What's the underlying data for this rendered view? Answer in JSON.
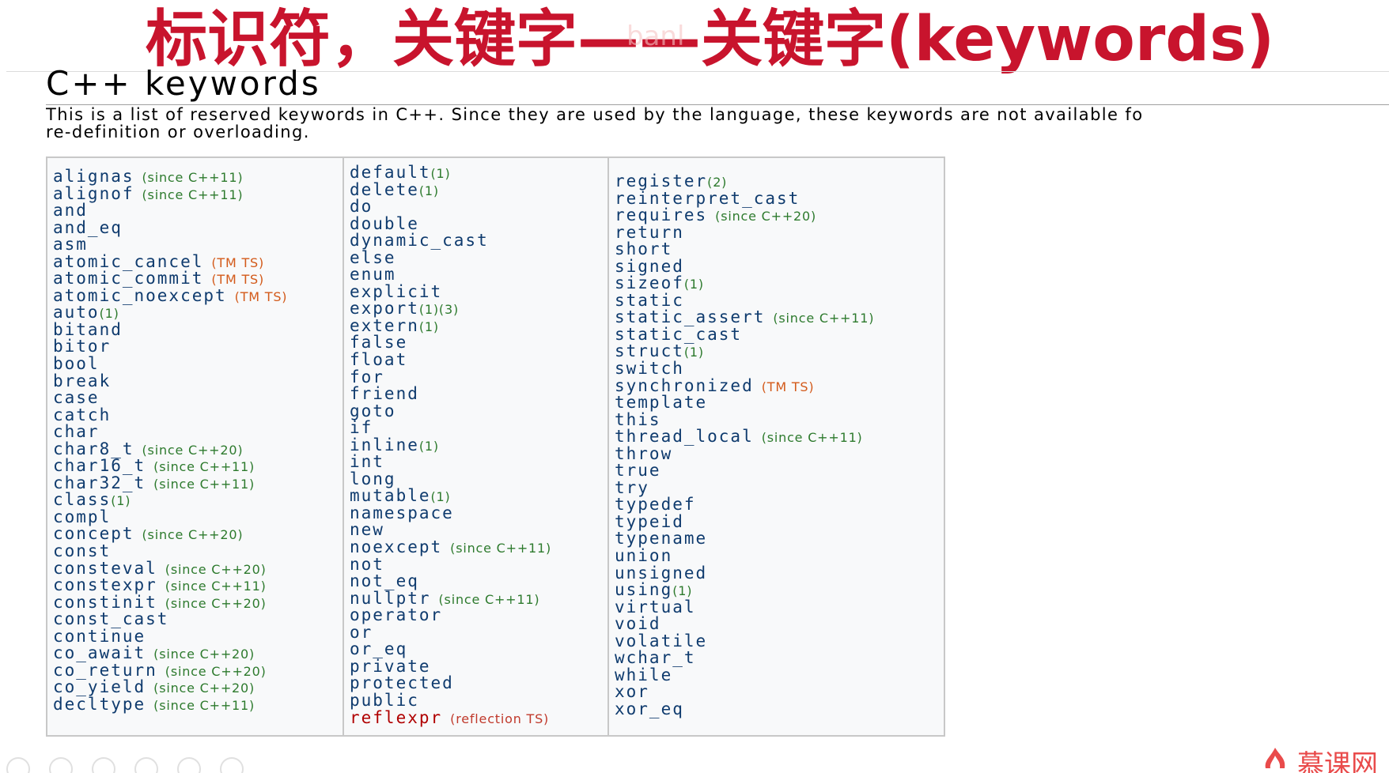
{
  "slide": {
    "title": "标识符，关键字——关键字(keywords)",
    "watermark": "banl",
    "brand": "慕课网",
    "title_color": "#c8142d"
  },
  "page": {
    "heading": "C++ keywords",
    "intro_line1": "This is a list of reserved keywords in C++. Since they are used by the language, these keywords are not available fo",
    "intro_line2": "re-definition or overloading."
  },
  "colors": {
    "keyword": "#0f3b6e",
    "note_green": "#2d7a2d",
    "note_orange": "#d35a1a",
    "note_red": "#c0392b",
    "reflexpr": "#b00000"
  },
  "columns": [
    {
      "items": [
        {
          "kw": "alignas",
          "note": "(since C++11)",
          "tone": "green"
        },
        {
          "kw": "alignof",
          "note": "(since C++11)",
          "tone": "green"
        },
        {
          "kw": "and"
        },
        {
          "kw": "and_eq"
        },
        {
          "kw": "asm"
        },
        {
          "kw": "atomic_cancel",
          "note": "(TM TS)",
          "tone": "orange"
        },
        {
          "kw": "atomic_commit",
          "note": "(TM TS)",
          "tone": "orange"
        },
        {
          "kw": "atomic_noexcept",
          "note": "(TM TS)",
          "tone": "orange"
        },
        {
          "kw": "auto",
          "sup": "(1)"
        },
        {
          "kw": "bitand"
        },
        {
          "kw": "bitor"
        },
        {
          "kw": "bool"
        },
        {
          "kw": "break"
        },
        {
          "kw": "case"
        },
        {
          "kw": "catch"
        },
        {
          "kw": "char"
        },
        {
          "kw": "char8_t",
          "note": "(since C++20)",
          "tone": "green"
        },
        {
          "kw": "char16_t",
          "note": "(since C++11)",
          "tone": "green"
        },
        {
          "kw": "char32_t",
          "note": "(since C++11)",
          "tone": "green"
        },
        {
          "kw": "class",
          "sup": "(1)"
        },
        {
          "kw": "compl"
        },
        {
          "kw": "concept",
          "note": "(since C++20)",
          "tone": "green"
        },
        {
          "kw": "const"
        },
        {
          "kw": "consteval",
          "note": "(since C++20)",
          "tone": "green"
        },
        {
          "kw": "constexpr",
          "note": "(since C++11)",
          "tone": "green"
        },
        {
          "kw": "constinit",
          "note": "(since C++20)",
          "tone": "green"
        },
        {
          "kw": "const_cast"
        },
        {
          "kw": "continue"
        },
        {
          "kw": "co_await",
          "note": "(since C++20)",
          "tone": "green"
        },
        {
          "kw": "co_return",
          "note": "(since C++20)",
          "tone": "green"
        },
        {
          "kw": "co_yield",
          "note": "(since C++20)",
          "tone": "green"
        },
        {
          "kw": "decltype",
          "note": "(since C++11)",
          "tone": "green"
        }
      ]
    },
    {
      "items": [
        {
          "kw": "default",
          "sup": "(1)"
        },
        {
          "kw": "delete",
          "sup": "(1)"
        },
        {
          "kw": "do"
        },
        {
          "kw": "double"
        },
        {
          "kw": "dynamic_cast"
        },
        {
          "kw": "else"
        },
        {
          "kw": "enum"
        },
        {
          "kw": "explicit"
        },
        {
          "kw": "export",
          "sup": "(1)(3)"
        },
        {
          "kw": "extern",
          "sup": "(1)"
        },
        {
          "kw": "false"
        },
        {
          "kw": "float"
        },
        {
          "kw": "for"
        },
        {
          "kw": "friend"
        },
        {
          "kw": "goto"
        },
        {
          "kw": "if"
        },
        {
          "kw": "inline",
          "sup": "(1)"
        },
        {
          "kw": "int"
        },
        {
          "kw": "long"
        },
        {
          "kw": "mutable",
          "sup": "(1)"
        },
        {
          "kw": "namespace"
        },
        {
          "kw": "new"
        },
        {
          "kw": "noexcept",
          "note": "(since C++11)",
          "tone": "green"
        },
        {
          "kw": "not"
        },
        {
          "kw": "not_eq"
        },
        {
          "kw": "nullptr",
          "note": "(since C++11)",
          "tone": "green"
        },
        {
          "kw": "operator"
        },
        {
          "kw": "or"
        },
        {
          "kw": "or_eq"
        },
        {
          "kw": "private"
        },
        {
          "kw": "protected"
        },
        {
          "kw": "public"
        },
        {
          "kw": "reflexpr",
          "note": "(reflection TS)",
          "tone": "red",
          "kwtone": "red"
        }
      ]
    },
    {
      "items": [
        {
          "kw": "register",
          "sup": "(2)"
        },
        {
          "kw": "reinterpret_cast"
        },
        {
          "kw": "requires",
          "note": "(since C++20)",
          "tone": "green"
        },
        {
          "kw": "return"
        },
        {
          "kw": "short"
        },
        {
          "kw": "signed"
        },
        {
          "kw": "sizeof",
          "sup": "(1)"
        },
        {
          "kw": "static"
        },
        {
          "kw": "static_assert",
          "note": "(since C++11)",
          "tone": "green"
        },
        {
          "kw": "static_cast"
        },
        {
          "kw": "struct",
          "sup": "(1)"
        },
        {
          "kw": "switch"
        },
        {
          "kw": "synchronized",
          "note": "(TM TS)",
          "tone": "orange"
        },
        {
          "kw": "template"
        },
        {
          "kw": "this"
        },
        {
          "kw": "thread_local",
          "note": "(since C++11)",
          "tone": "green"
        },
        {
          "kw": "throw"
        },
        {
          "kw": "true"
        },
        {
          "kw": "try"
        },
        {
          "kw": "typedef"
        },
        {
          "kw": "typeid"
        },
        {
          "kw": "typename"
        },
        {
          "kw": "union"
        },
        {
          "kw": "unsigned"
        },
        {
          "kw": "using",
          "sup": "(1)"
        },
        {
          "kw": "virtual"
        },
        {
          "kw": "void"
        },
        {
          "kw": "volatile"
        },
        {
          "kw": "wchar_t"
        },
        {
          "kw": "while"
        },
        {
          "kw": "xor"
        },
        {
          "kw": "xor_eq"
        }
      ]
    }
  ]
}
